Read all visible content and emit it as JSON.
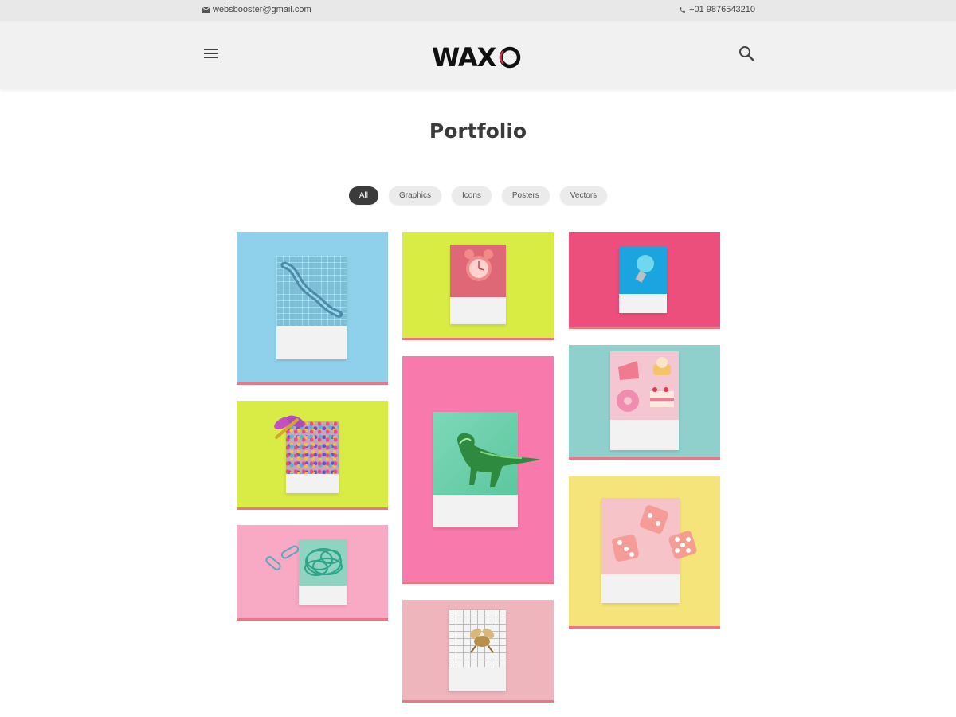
{
  "topbar": {
    "email": "websbooster@gmail.com",
    "phone": "+01 9876543210"
  },
  "header": {
    "logo_text": "WAXO",
    "logo_accent_color": "#e8354b"
  },
  "page": {
    "title": "Portfolio"
  },
  "filters": [
    {
      "label": "All",
      "active": true
    },
    {
      "label": "Graphics",
      "active": false
    },
    {
      "label": "Icons",
      "active": false
    },
    {
      "label": "Posters",
      "active": false
    },
    {
      "label": "Vectors",
      "active": false
    }
  ],
  "portfolio": {
    "accent_color": "#f07582",
    "items": [
      {
        "subject": "blue toy worm on grid card",
        "background": "#8fd0ea"
      },
      {
        "subject": "pink alarm clock",
        "background": "#d8ec43"
      },
      {
        "subject": "blue light bulb",
        "background": "#ec4f7c"
      },
      {
        "subject": "purple dragonfly on glitter card",
        "background": "#d9ec45"
      },
      {
        "subject": "green toy dinosaur",
        "background": "#f879ab"
      },
      {
        "subject": "sweets and cupcakes",
        "background": "#8fd0cc"
      },
      {
        "subject": "green paper clips",
        "background": "#f8a9c4"
      },
      {
        "subject": "pink dice",
        "background": "#f5e47a"
      },
      {
        "subject": "gold toy bee on grid card",
        "background": "#efb5bd"
      }
    ]
  }
}
